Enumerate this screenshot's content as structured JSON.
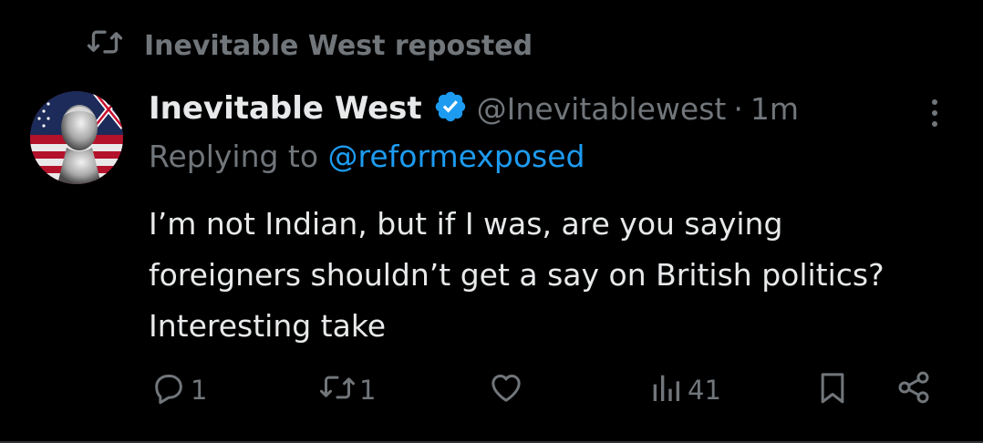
{
  "repost": {
    "text": "Inevitable West reposted",
    "icon": "repost-icon"
  },
  "post": {
    "author_name": "Inevitable West",
    "verified": true,
    "handle": "@Inevitablewest",
    "separator": "·",
    "time": "1m",
    "replying_prefix": "Replying to",
    "replying_to": "@reformexposed",
    "text": "I’m not Indian, but if I was, are you saying foreigners shouldn’t get a say on British politics? Interesting take"
  },
  "actions": {
    "replies": "1",
    "reposts": "1",
    "views": "41"
  },
  "colors": {
    "background": "#000000",
    "primary_text": "#e7e9ea",
    "secondary_text": "#71767b",
    "accent": "#1d9bf0"
  }
}
